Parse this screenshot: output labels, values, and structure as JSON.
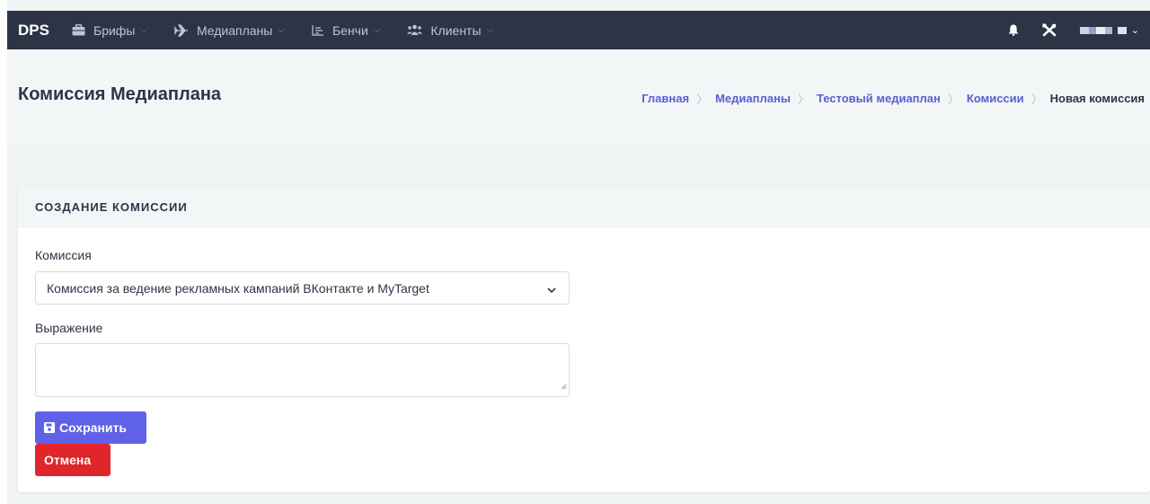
{
  "navbar": {
    "brand": "DPS",
    "items": [
      {
        "label": "Брифы",
        "icon": "briefcase-icon"
      },
      {
        "label": "Медиапланы",
        "icon": "plane-icon"
      },
      {
        "label": "Бенчи",
        "icon": "chart-icon"
      },
      {
        "label": "Клиенты",
        "icon": "users-icon"
      }
    ],
    "right_icons": [
      "bell-icon",
      "tools-icon"
    ]
  },
  "page": {
    "title": "Комиссия Медиаплана",
    "breadcrumb": [
      "Главная",
      "Медиапланы",
      "Тестовый медиаплан",
      "Комиссии",
      "Новая комиссия"
    ]
  },
  "card": {
    "header": "СОЗДАНИЕ КОМИССИИ",
    "commission_label": "Комиссия",
    "commission_value": "Комиссия за ведение рекламных кампаний ВКонтакте и MyTarget",
    "expression_label": "Выражение",
    "expression_value": "",
    "save_label": "Сохранить",
    "cancel_label": "Отмена"
  },
  "colors": {
    "navbar": "#2d3446",
    "accent": "#5a5fcf",
    "save": "#5f62e8",
    "cancel": "#e0262b"
  }
}
